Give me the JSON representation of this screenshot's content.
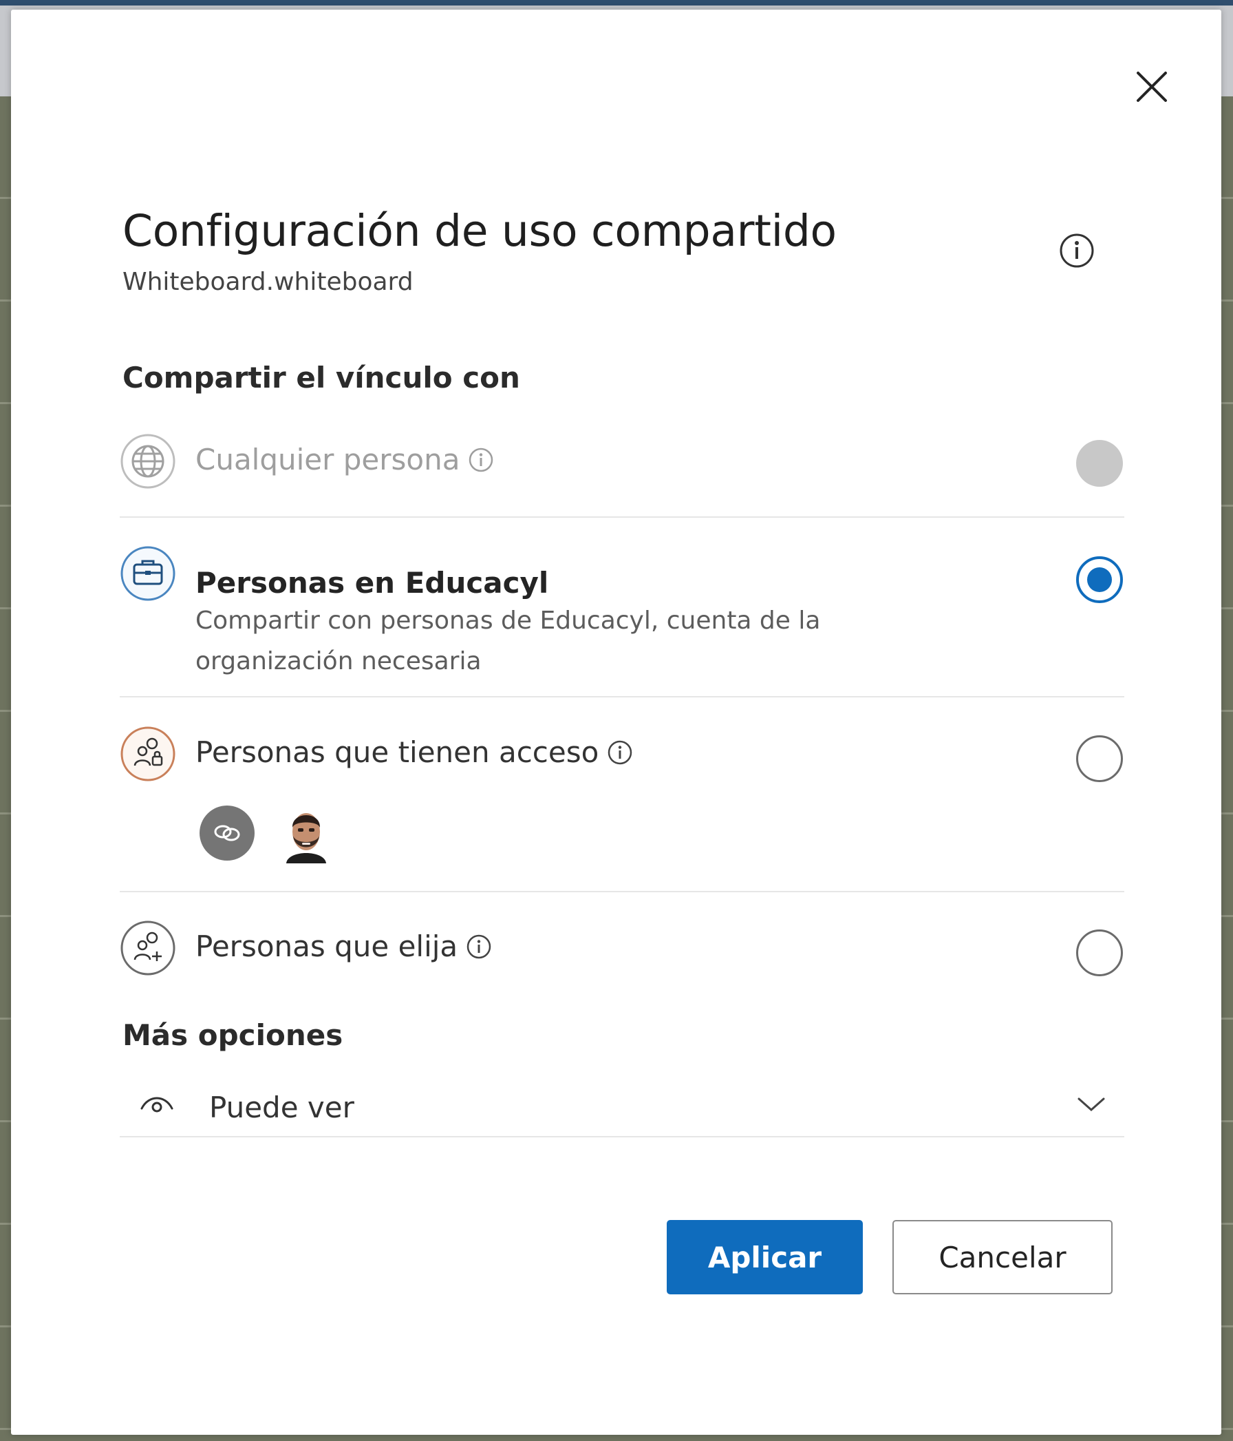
{
  "dialog": {
    "title": "Configuración de uso compartido",
    "subtitle": "Whiteboard.whiteboard",
    "close_icon": "close-icon",
    "info_icon": "info-icon"
  },
  "share_section": {
    "heading": "Compartir el vínculo con",
    "options": [
      {
        "label": "Cualquier persona",
        "icon": "globe-icon",
        "has_info": true,
        "state": "disabled"
      },
      {
        "label": "Personas en Educacyl",
        "description": "Compartir con personas de Educacyl, cuenta de la organización necesaria",
        "icon": "briefcase-icon",
        "state": "selected"
      },
      {
        "label": "Personas que tienen acceso",
        "icon": "people-lock-icon",
        "has_info": true,
        "state": "unselected"
      },
      {
        "label": "Personas que elija",
        "icon": "people-add-icon",
        "has_info": true,
        "state": "unselected"
      }
    ],
    "access_avatars": [
      "link-icon",
      "user-avatar"
    ]
  },
  "more_options": {
    "heading": "Más opciones",
    "permission": {
      "label": "Puede ver",
      "icon": "eye-icon",
      "dropdown_icon": "chevron-down-icon"
    }
  },
  "buttons": {
    "apply_label": "Aplicar",
    "cancel_label": "Cancelar"
  },
  "colors": {
    "accent": "#0f6cbd",
    "disabled_radio": "#c8c8c8"
  }
}
